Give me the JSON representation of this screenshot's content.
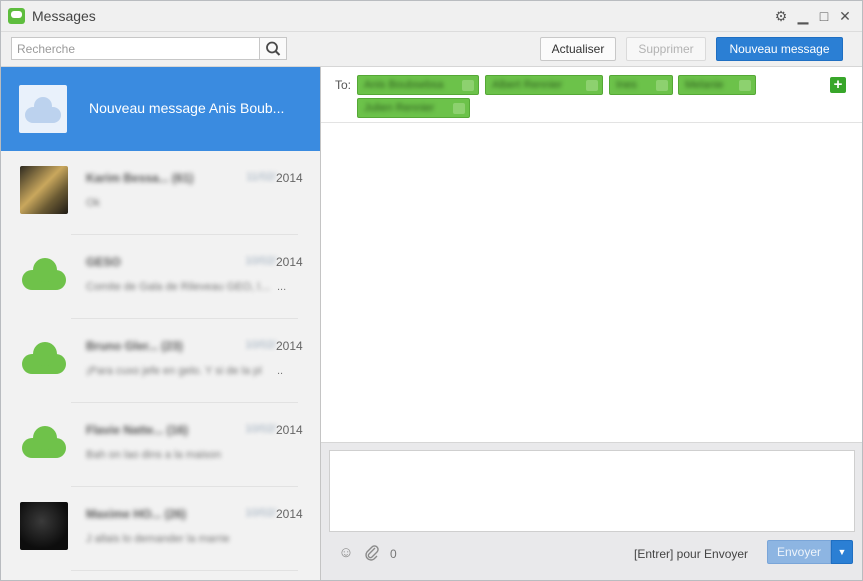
{
  "window": {
    "title": "Messages",
    "controls": {
      "settings": "⚙",
      "minimize": "▁",
      "maximize": "□",
      "close": "✕"
    }
  },
  "toolbar": {
    "search_placeholder": "Recherche",
    "refresh_label": "Actualiser",
    "delete_label": "Supprimer",
    "new_message_label": "Nouveau message"
  },
  "conversations": [
    {
      "name": "Nouveau message Anis Boub...",
      "selected": true
    },
    {
      "name": "Karim Bessa... (61)",
      "date": "11/02/",
      "year": "2014",
      "preview": "Ok",
      "avatar": "photo"
    },
    {
      "name": "GESO",
      "date": "10/02/",
      "year": "2014",
      "preview": "Comite de Gala de Rileveau GEO, le club",
      "ellipsis": "...",
      "avatar": "cloud"
    },
    {
      "name": "Bruno Gler... (23)",
      "date": "10/02/",
      "year": "2014",
      "preview": "¡Para cuxo jefe en gelo. Y si de la pl",
      "ellipsis": "..",
      "avatar": "cloud"
    },
    {
      "name": "Flavie Natte... (16)",
      "date": "10/02/",
      "year": "2014",
      "preview": "Bah on lao dins a la maison",
      "avatar": "cloud"
    },
    {
      "name": "Maxime HO... (26)",
      "date": "10/02/",
      "year": "2014",
      "preview": "J allais lo demander la marrie",
      "avatar": "photo"
    }
  ],
  "compose": {
    "to_label": "To:",
    "recipients": [
      "Anis Boubsebsa",
      "Albert Rennier",
      "Ines",
      "Melanie",
      "Julien Rennier"
    ],
    "add_recipient": "+",
    "attachment_count": "0",
    "send_hint": "[Entrer] pour Envoyer",
    "send_label": "Envoyer",
    "send_menu": "▼",
    "emoji_icon": "☺",
    "attach_icon": "⌀"
  },
  "colors": {
    "accent": "#2b7fd4",
    "selected_row": "#3a8be0",
    "recipient_chip": "#6cc24a"
  }
}
